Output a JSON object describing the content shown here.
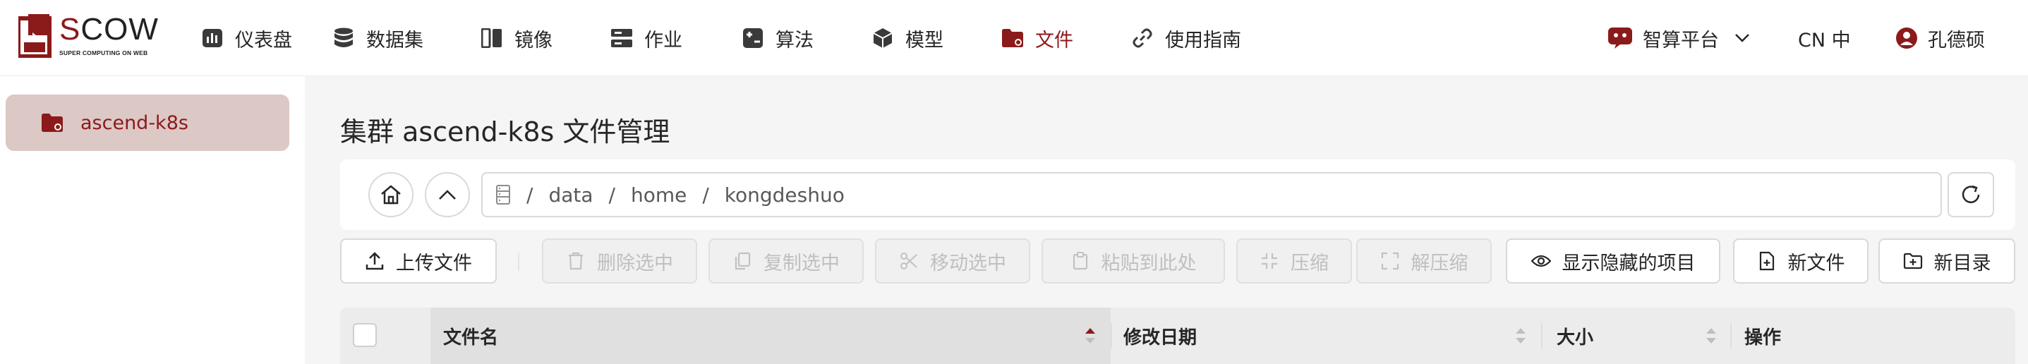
{
  "app": {
    "logo_word_accent": "S",
    "logo_word_rest": "COW",
    "logo_subtitle": "SUPER COMPUTING ON WEB"
  },
  "nav": {
    "items": [
      {
        "label": "仪表盘",
        "icon": "dashboard-icon"
      },
      {
        "label": "数据集",
        "icon": "database-icon"
      },
      {
        "label": "镜像",
        "icon": "image-icon"
      },
      {
        "label": "作业",
        "icon": "job-icon"
      },
      {
        "label": "算法",
        "icon": "algorithm-icon"
      },
      {
        "label": "模型",
        "icon": "model-cube-icon"
      },
      {
        "label": "文件",
        "icon": "folder-icon",
        "active": true
      },
      {
        "label": "使用指南",
        "icon": "link-icon"
      }
    ],
    "platform_label": "智算平台",
    "language_label": "CN 中",
    "user_name": "孔德硕"
  },
  "sidebar": {
    "items": [
      {
        "label": "ascend-k8s",
        "icon": "folder-icon",
        "selected": true
      }
    ]
  },
  "page": {
    "title": "集群 ascend-k8s 文件管理"
  },
  "path": {
    "segments": [
      "data",
      "home",
      "kongdeshuo"
    ],
    "separator": "/"
  },
  "toolbar": {
    "upload": "上传文件",
    "delete_selected": "删除选中",
    "copy_selected": "复制选中",
    "move_selected": "移动选中",
    "paste_here": "粘贴到此处",
    "compress": "压缩",
    "decompress": "解压缩",
    "show_hidden": "显示隐藏的项目",
    "new_file": "新文件",
    "new_dir": "新目录"
  },
  "table": {
    "columns": [
      "文件名",
      "修改日期",
      "大小",
      "操作"
    ]
  },
  "colors": {
    "accent": "#8b1a1a",
    "sidebar_selected_bg": "#dcc8c5",
    "disabled_text": "#bfbfbf"
  }
}
